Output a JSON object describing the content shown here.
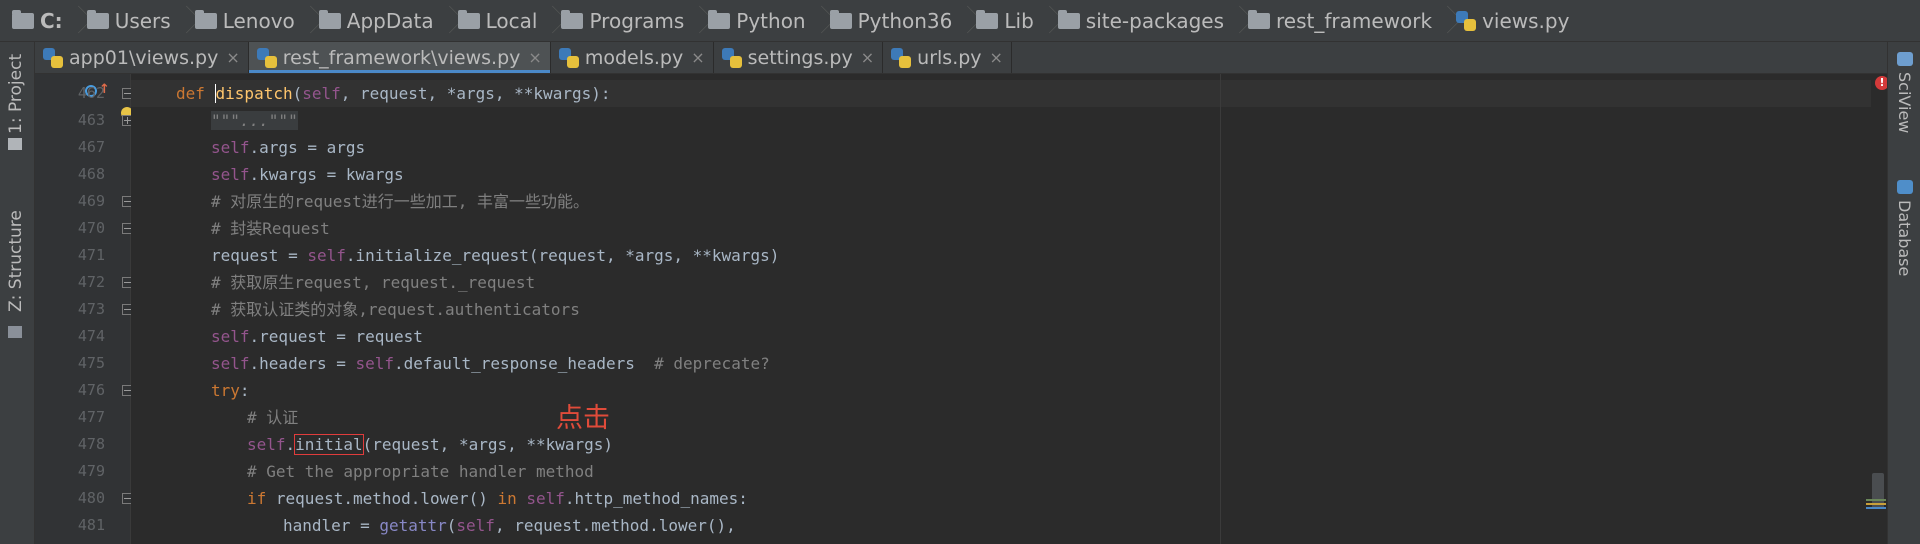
{
  "breadcrumb": [
    {
      "label": "C:",
      "type": "folder",
      "bold": true
    },
    {
      "label": "Users",
      "type": "folder"
    },
    {
      "label": "Lenovo",
      "type": "folder"
    },
    {
      "label": "AppData",
      "type": "folder"
    },
    {
      "label": "Local",
      "type": "folder"
    },
    {
      "label": "Programs",
      "type": "folder"
    },
    {
      "label": "Python",
      "type": "folder"
    },
    {
      "label": "Python36",
      "type": "folder"
    },
    {
      "label": "Lib",
      "type": "folder"
    },
    {
      "label": "site-packages",
      "type": "folder"
    },
    {
      "label": "rest_framework",
      "type": "folder"
    },
    {
      "label": "views.py",
      "type": "python-file"
    }
  ],
  "tabs": [
    {
      "label": "app01\\views.py",
      "active": false,
      "close": "×"
    },
    {
      "label": "rest_framework\\views.py",
      "active": true,
      "close": "×"
    },
    {
      "label": "models.py",
      "active": false,
      "close": "×"
    },
    {
      "label": "settings.py",
      "active": false,
      "close": "×"
    },
    {
      "label": "urls.py",
      "active": false,
      "close": "×"
    }
  ],
  "left_tool_windows": {
    "project": "1: Project",
    "structure": "Z: Structure"
  },
  "right_tool_windows": {
    "sciview": "SciView",
    "database": "Database"
  },
  "editor": {
    "line_numbers": [
      "462",
      "463",
      "467",
      "468",
      "469",
      "470",
      "471",
      "472",
      "473",
      "474",
      "475",
      "476",
      "477",
      "478",
      "479",
      "480",
      "481"
    ],
    "annotation": "点击",
    "highlighted_token": "initial",
    "error_indicator": "!"
  },
  "colors": {
    "keyword": "#cc7832",
    "self": "#94558d",
    "function": "#ffc66d",
    "comment": "#808080",
    "annotation": "#e04b3a",
    "highlight_box": "#e03c3c"
  }
}
